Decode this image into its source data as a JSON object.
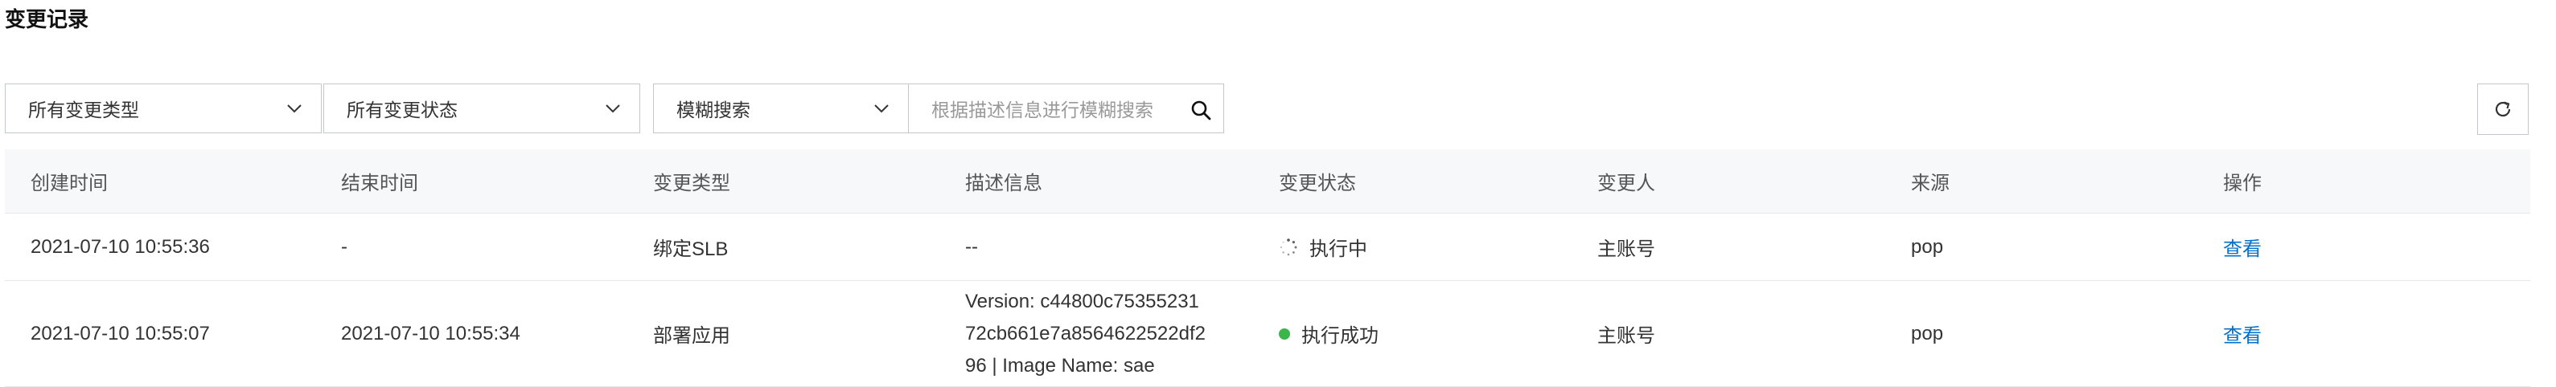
{
  "page": {
    "title": "变更记录"
  },
  "filters": {
    "change_type": "所有变更类型",
    "change_status": "所有变更状态",
    "search_mode": "模糊搜索",
    "search_placeholder": "根据描述信息进行模糊搜索"
  },
  "colors": {
    "link": "#0070cc",
    "success": "#3cb54a",
    "header_bg": "#f7f8fa"
  },
  "table": {
    "headers": [
      "创建时间",
      "结束时间",
      "变更类型",
      "描述信息",
      "变更状态",
      "变更人",
      "来源",
      "操作"
    ],
    "rows": [
      {
        "created": "2021-07-10 10:55:36",
        "ended": "-",
        "type": "绑定SLB",
        "description": [
          "--"
        ],
        "status": "执行中",
        "status_icon": "loading-spinner-icon",
        "operator": "主账号",
        "source": "pop",
        "action": "查看"
      },
      {
        "created": "2021-07-10 10:55:07",
        "ended": "2021-07-10 10:55:34",
        "type": "部署应用",
        "description": [
          "Version: c44800c75355231",
          "72cb661e7a8564622522df2",
          "96 | Image Name: sae"
        ],
        "status": "执行成功",
        "status_icon": "success-dot-icon",
        "operator": "主账号",
        "source": "pop",
        "action": "查看"
      }
    ]
  }
}
